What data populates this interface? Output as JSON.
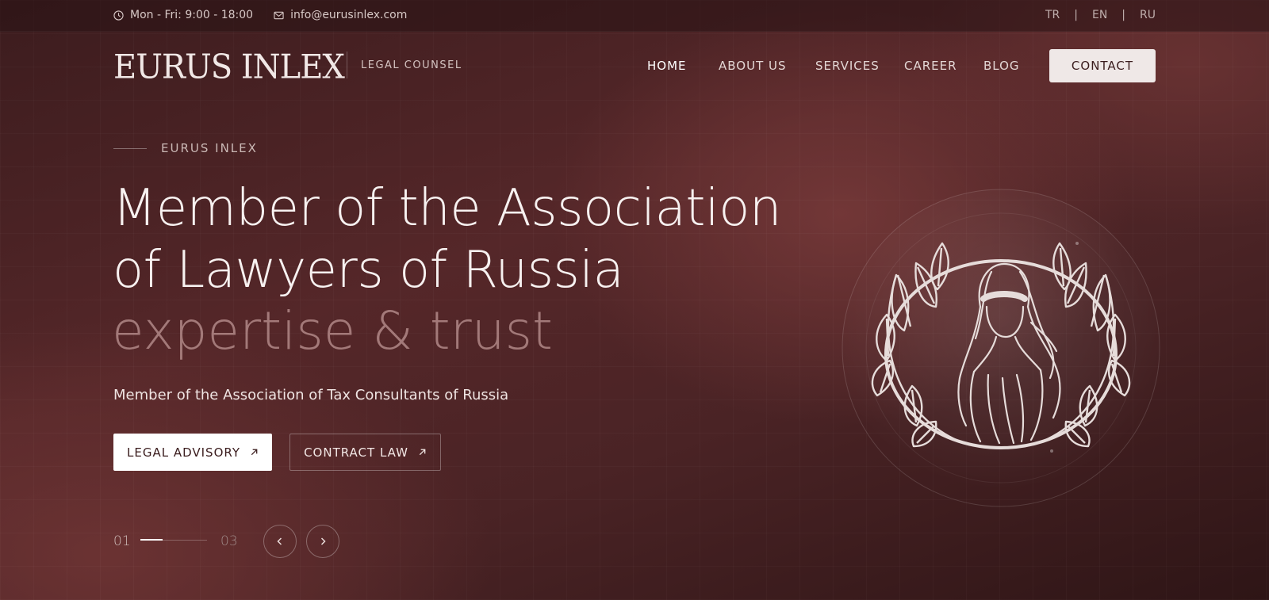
{
  "topbar": {
    "hours": "Mon - Fri: 9:00 - 18:00",
    "email": "info@eurusinlex.com",
    "languages": [
      "TR",
      "EN",
      "RU"
    ],
    "separator": "|"
  },
  "header": {
    "logo": "EURUS INLEX",
    "tagline": "LEGAL COUNSEL",
    "nav": [
      "HOME",
      "ABOUT US",
      "SERVICES",
      "CAREER",
      "BLOG"
    ],
    "contact_label": "CONTACT"
  },
  "hero": {
    "eyebrow": "EURUS INLEX",
    "headline_line1": "Member of the Association",
    "headline_line2": "of Lawyers of Russia",
    "subheadline": "expertise & trust",
    "description": "Member of the Association of Tax Consultants of Russia",
    "primary_button": "LEGAL ADVISORY",
    "secondary_button": "CONTRACT LAW"
  },
  "slider": {
    "current": "01",
    "total": "03",
    "progress": 0.33
  },
  "icons": {
    "clock": "clock-icon",
    "mail": "mail-icon",
    "arrow": "arrow-up-right-icon",
    "prev": "chevron-left-icon",
    "next": "chevron-right-icon",
    "emblem": "lady-justice-laurel-emblem"
  },
  "colors": {
    "background": "#4a2325",
    "accent": "#efe8e7",
    "text": "#f7f1f0",
    "muted": "#be9694"
  }
}
